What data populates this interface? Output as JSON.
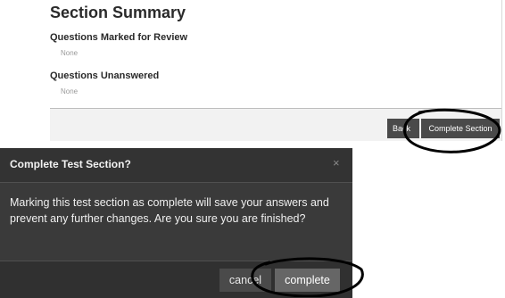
{
  "summary": {
    "title": "Section Summary",
    "review_heading": "Questions Marked for Review",
    "review_value": "None",
    "unanswered_heading": "Questions Unanswered",
    "unanswered_value": "None",
    "back_label": "Back",
    "complete_section_label": "Complete Section"
  },
  "dialog": {
    "title": "Complete Test Section?",
    "close_glyph": "×",
    "message": "Marking this test section as complete will save your answers and prevent any further changes. Are you sure you are finished?",
    "cancel_label": "cancel",
    "complete_label": "complete"
  },
  "colors": {
    "dialog_bg": "#3a3a3a",
    "button_bg": "#4a4a4a",
    "annotation": "#000000"
  },
  "icons": {
    "close": "close-icon"
  }
}
